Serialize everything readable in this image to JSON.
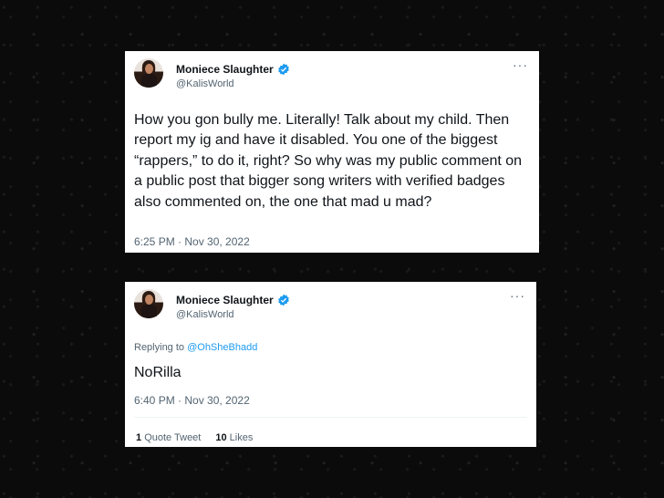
{
  "tweet1": {
    "name": "Moniece Slaughter",
    "handle": "@KalisWorld",
    "more": "···",
    "text": "How you gon bully me. Literally! Talk about my child. Then report my ig and have it disabled. You one of the biggest “rappers,” to do it, right? So why was my public comment on a public post that bigger song writers with verified badges also commented on, the one that mad u mad?",
    "timestamp": "6:25 PM · Nov 30, 2022"
  },
  "tweet2": {
    "name": "Moniece Slaughter",
    "handle": "@KalisWorld",
    "more": "···",
    "replying_label": "Replying to ",
    "replying_to": "@OhSheBhadd",
    "text": "NoRilla",
    "timestamp": "6:40 PM · Nov 30, 2022",
    "quote_count": "1",
    "quote_label": "Quote Tweet",
    "likes_count": "10",
    "likes_label": "Likes"
  },
  "colors": {
    "verified": "#1d9bf0",
    "mention": "#1d9bf0",
    "text": "#0f1419",
    "muted": "#536471"
  },
  "icons": [
    "verified-badge-icon",
    "more-options-icon"
  ]
}
